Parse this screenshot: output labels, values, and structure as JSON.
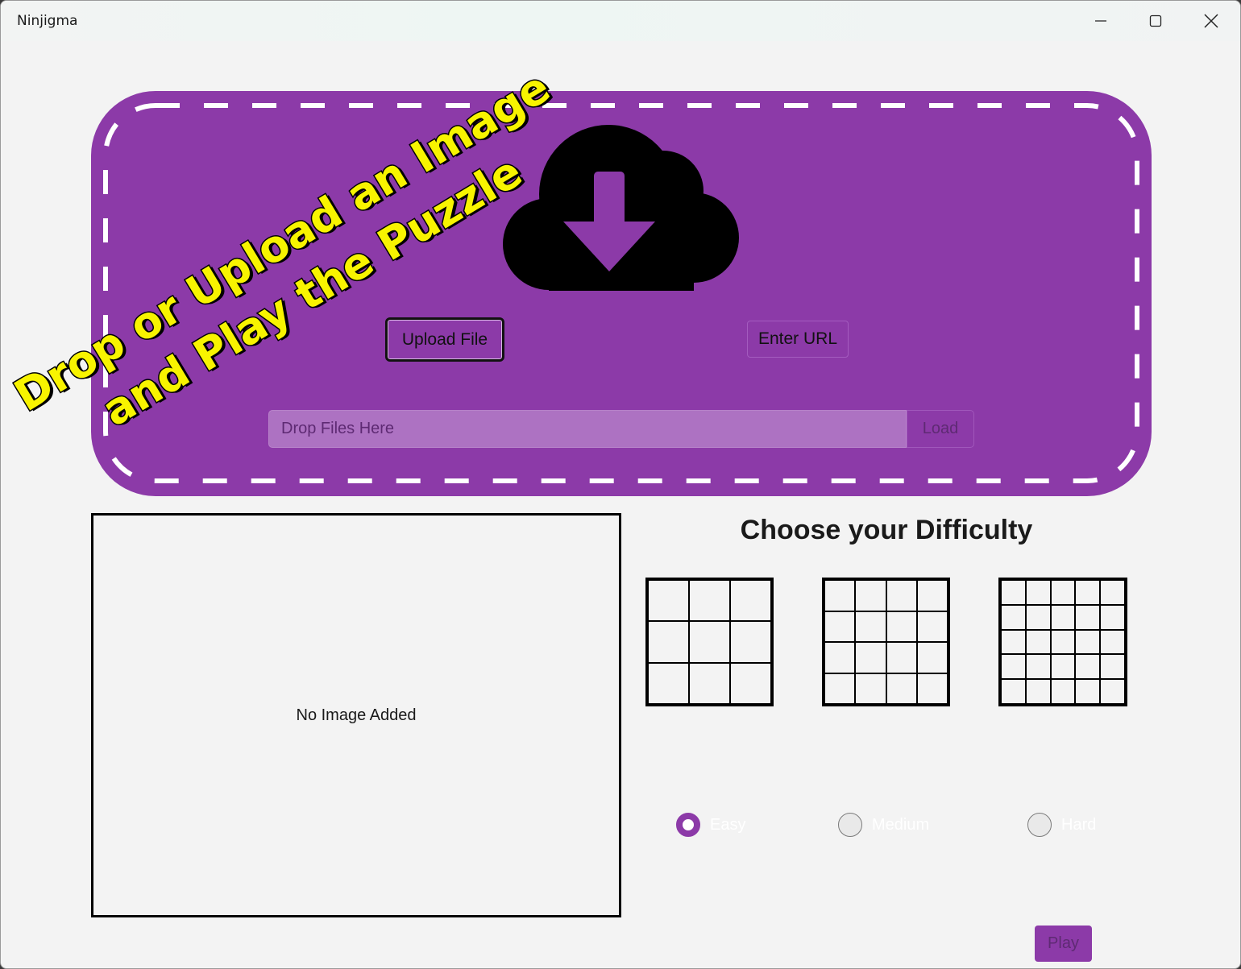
{
  "window": {
    "title": "Ninjigma",
    "controls": [
      "minimize-icon",
      "maximize-icon",
      "close-icon"
    ]
  },
  "dropzone": {
    "banner_line1": "Drop or Upload an Image",
    "banner_line2": "and Play the Puzzle",
    "icon": "cloud-download-icon",
    "upload_button": "Upload File",
    "url_button": "Enter URL",
    "drop_placeholder": "Drop Files Here",
    "load_button": "Load"
  },
  "preview": {
    "empty_text": "No Image Added"
  },
  "difficulty": {
    "title": "Choose your Difficulty",
    "options": [
      {
        "label": "Easy",
        "grid": 3,
        "checked": true
      },
      {
        "label": "Medium",
        "grid": 4,
        "checked": false
      },
      {
        "label": "Hard",
        "grid": 5,
        "checked": false
      }
    ]
  },
  "play_button": "Play",
  "colors": {
    "accent": "#8c3aa8",
    "banner_text": "#f8f400",
    "background": "#f3f3f3"
  }
}
